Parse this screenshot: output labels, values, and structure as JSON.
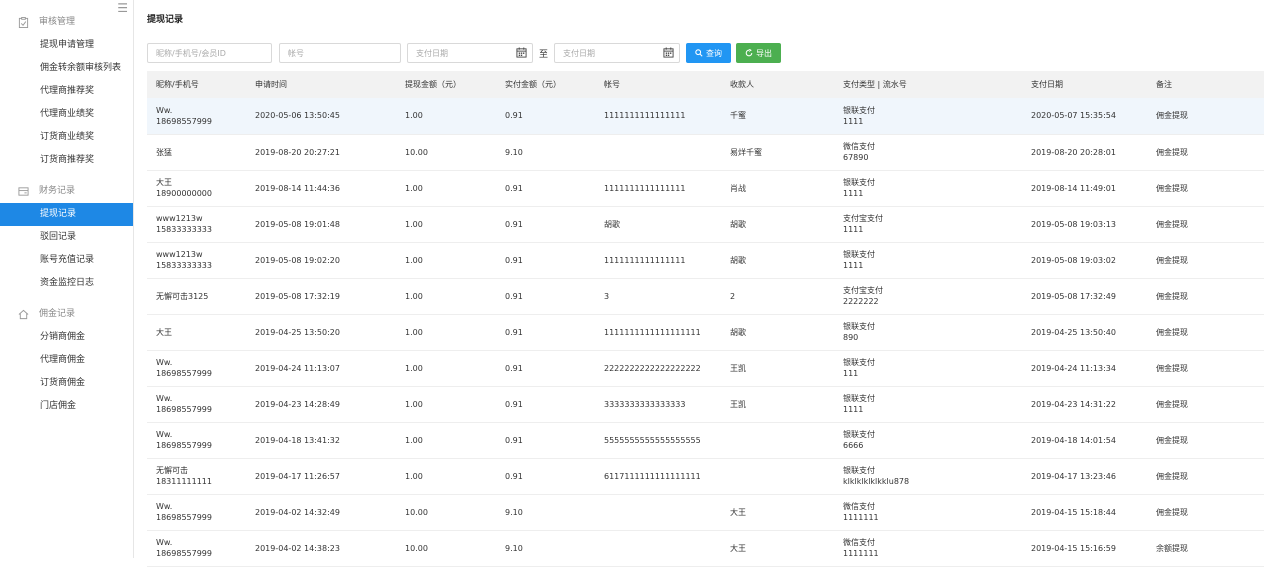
{
  "sidebar": {
    "collapse_icon": "hamburger-icon",
    "groups": [
      {
        "title": "审核管理",
        "icon": "clipboard-check-icon",
        "items": [
          "提现申请管理",
          "佣金转余额审核列表",
          "代理商推荐奖",
          "代理商业绩奖",
          "订货商业绩奖",
          "订货商推荐奖"
        ]
      },
      {
        "title": "财务记录",
        "icon": "ledger-icon",
        "items": [
          "提现记录",
          "驳回记录",
          "账号充值记录",
          "资金监控日志"
        ]
      },
      {
        "title": "佣金记录",
        "icon": "home-icon",
        "items": [
          "分销商佣金",
          "代理商佣金",
          "订货商佣金",
          "门店佣金"
        ]
      }
    ],
    "active_item": "提现记录"
  },
  "page": {
    "title": "提现记录"
  },
  "filters": {
    "member_placeholder": "昵称/手机号/会员ID",
    "account_placeholder": "帐号",
    "date_from_placeholder": "支付日期",
    "to_label": "至",
    "date_to_placeholder": "支付日期",
    "query_label": "查询",
    "export_label": "导出"
  },
  "colors": {
    "active_menu": "#1e88e5",
    "query_button": "#2196f3",
    "export_button": "#4caf50"
  },
  "table": {
    "headers": [
      "昵称/手机号",
      "申请时间",
      "提现金额（元）",
      "实付金额（元）",
      "帐号",
      "收款人",
      "支付类型 | 流水号",
      "支付日期",
      "备注"
    ],
    "rows": [
      {
        "nick": "Ww.",
        "phone": "18698557999",
        "apply": "2020-05-06 13:50:45",
        "amount": "1.00",
        "paid": "0.91",
        "account": "1111111111111111",
        "payee": "千蜜",
        "paytype": "银联支付",
        "serial": "1111",
        "paydate": "2020-05-07 15:35:54",
        "note": "佣金提现"
      },
      {
        "nick": "张猛",
        "phone": "",
        "apply": "2019-08-20 20:27:21",
        "amount": "10.00",
        "paid": "9.10",
        "account": "",
        "payee": "易烊千蜜",
        "paytype": "微信支付",
        "serial": "67890",
        "paydate": "2019-08-20 20:28:01",
        "note": "佣金提现"
      },
      {
        "nick": "大王",
        "phone": "18900000000",
        "apply": "2019-08-14 11:44:36",
        "amount": "1.00",
        "paid": "0.91",
        "account": "1111111111111111",
        "payee": "肖战",
        "paytype": "银联支付",
        "serial": "1111",
        "paydate": "2019-08-14 11:49:01",
        "note": "佣金提现"
      },
      {
        "nick": "www1213w",
        "phone": "15833333333",
        "apply": "2019-05-08 19:01:48",
        "amount": "1.00",
        "paid": "0.91",
        "account": "胡歌",
        "payee": "胡歌",
        "paytype": "支付宝支付",
        "serial": "1111",
        "paydate": "2019-05-08 19:03:13",
        "note": "佣金提现"
      },
      {
        "nick": "www1213w",
        "phone": "15833333333",
        "apply": "2019-05-08 19:02:20",
        "amount": "1.00",
        "paid": "0.91",
        "account": "1111111111111111",
        "payee": "胡歌",
        "paytype": "银联支付",
        "serial": "1111",
        "paydate": "2019-05-08 19:03:02",
        "note": "佣金提现"
      },
      {
        "nick": "无懈可击3125",
        "phone": "",
        "apply": "2019-05-08 17:32:19",
        "amount": "1.00",
        "paid": "0.91",
        "account": "3",
        "payee": "2",
        "paytype": "支付宝支付",
        "serial": "2222222",
        "paydate": "2019-05-08 17:32:49",
        "note": "佣金提现"
      },
      {
        "nick": "大王",
        "phone": "",
        "apply": "2019-04-25 13:50:20",
        "amount": "1.00",
        "paid": "0.91",
        "account": "1111111111111111111",
        "payee": "胡歌",
        "paytype": "银联支付",
        "serial": "890",
        "paydate": "2019-04-25 13:50:40",
        "note": "佣金提现"
      },
      {
        "nick": "Ww.",
        "phone": "18698557999",
        "apply": "2019-04-24 11:13:07",
        "amount": "1.00",
        "paid": "0.91",
        "account": "2222222222222222222",
        "payee": "王凯",
        "paytype": "银联支付",
        "serial": "111",
        "paydate": "2019-04-24 11:13:34",
        "note": "佣金提现"
      },
      {
        "nick": "Ww.",
        "phone": "18698557999",
        "apply": "2019-04-23 14:28:49",
        "amount": "1.00",
        "paid": "0.91",
        "account": "3333333333333333",
        "payee": "王凯",
        "paytype": "银联支付",
        "serial": "1111",
        "paydate": "2019-04-23 14:31:22",
        "note": "佣金提现"
      },
      {
        "nick": "Ww.",
        "phone": "18698557999",
        "apply": "2019-04-18 13:41:32",
        "amount": "1.00",
        "paid": "0.91",
        "account": "5555555555555555555",
        "payee": "",
        "paytype": "银联支付",
        "serial": "6666",
        "paydate": "2019-04-18 14:01:54",
        "note": "佣金提现"
      },
      {
        "nick": "无懈可击",
        "phone": "18311111111",
        "apply": "2019-04-17 11:26:57",
        "amount": "1.00",
        "paid": "0.91",
        "account": "6117111111111111111",
        "payee": "",
        "paytype": "银联支付",
        "serial": "klklklklklkklu878",
        "paydate": "2019-04-17 13:23:46",
        "note": "佣金提现"
      },
      {
        "nick": "Ww.",
        "phone": "18698557999",
        "apply": "2019-04-02 14:32:49",
        "amount": "10.00",
        "paid": "9.10",
        "account": "",
        "payee": "大王",
        "paytype": "微信支付",
        "serial": "1111111",
        "paydate": "2019-04-15 15:18:44",
        "note": "佣金提现"
      },
      {
        "nick": "Ww.",
        "phone": "18698557999",
        "apply": "2019-04-02 14:38:23",
        "amount": "10.00",
        "paid": "9.10",
        "account": "",
        "payee": "大王",
        "paytype": "微信支付",
        "serial": "1111111",
        "paydate": "2019-04-15 15:16:59",
        "note": "余额提现"
      }
    ]
  }
}
